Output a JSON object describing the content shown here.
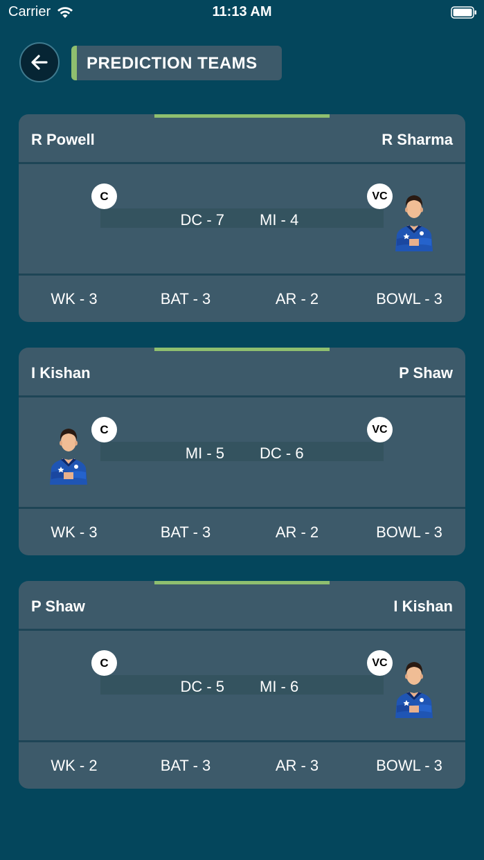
{
  "status_bar": {
    "carrier": "Carrier",
    "time": "11:13 AM"
  },
  "header": {
    "title": "PREDICTION TEAMS"
  },
  "colors": {
    "background": "#04465c",
    "card": "#3d5a6a",
    "accent": "#8fbf6f"
  },
  "teams": [
    {
      "captain": "R Powell",
      "vice_captain": "R Sharma",
      "captain_badge": "C",
      "vice_captain_badge": "VC",
      "team_left": "DC - 7",
      "team_right": "MI - 4",
      "avatar_side": "right",
      "stats": [
        "WK - 3",
        "BAT - 3",
        "AR - 2",
        "BOWL - 3"
      ]
    },
    {
      "captain": "I Kishan",
      "vice_captain": "P Shaw",
      "captain_badge": "C",
      "vice_captain_badge": "VC",
      "team_left": "MI - 5",
      "team_right": "DC - 6",
      "avatar_side": "left",
      "stats": [
        "WK - 3",
        "BAT - 3",
        "AR - 2",
        "BOWL - 3"
      ]
    },
    {
      "captain": "P Shaw",
      "vice_captain": "I Kishan",
      "captain_badge": "C",
      "vice_captain_badge": "VC",
      "team_left": "DC - 5",
      "team_right": "MI - 6",
      "avatar_side": "right",
      "stats": [
        "WK - 2",
        "BAT - 3",
        "AR - 3",
        "BOWL - 3"
      ]
    }
  ]
}
